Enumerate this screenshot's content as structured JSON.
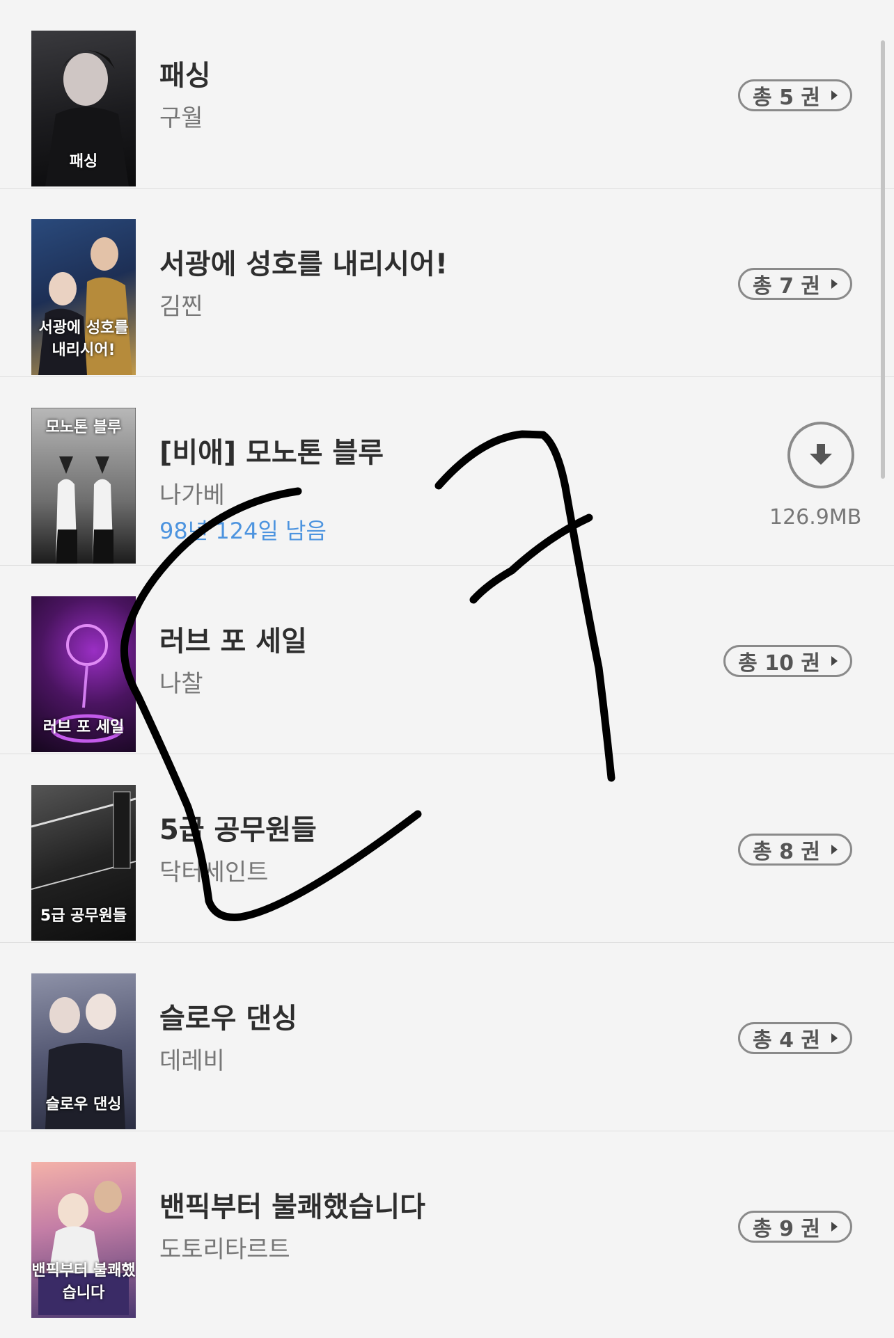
{
  "books": [
    {
      "title": "패싱",
      "author": "구월",
      "count_label": "총 5 권",
      "cover_text": "패싱",
      "cover_colors": [
        "#2b2b2e",
        "#0d0d0f"
      ]
    },
    {
      "title": "서광에 성호를 내리시어!",
      "author": "김찐",
      "count_label": "총 7 권",
      "cover_text": "서광에 성호를 내리시어!",
      "cover_colors": [
        "#1f3763",
        "#b48a3a"
      ]
    },
    {
      "title": "[비애] 모노톤 블루",
      "author": "나가베",
      "remaining": "98년 124일 남음",
      "size": "126.9MB",
      "cover_text": "모노톤 블루",
      "cover_colors": [
        "#9a9a9a",
        "#1a1a1a"
      ]
    },
    {
      "title": "러브 포 세일",
      "author": "나찰",
      "count_label": "총 10 권",
      "cover_text": "러브 포 세일",
      "cover_colors": [
        "#3a0f4a",
        "#b042d8"
      ]
    },
    {
      "title": "5급 공무원들",
      "author": "닥터세인트",
      "count_label": "총 8 권",
      "cover_text": "5급 공무원들",
      "cover_colors": [
        "#3b3b3b",
        "#0f0f0f"
      ]
    },
    {
      "title": "슬로우 댄싱",
      "author": "데레비",
      "count_label": "총 4 권",
      "cover_text": "슬로우 댄싱",
      "cover_colors": [
        "#6b6e86",
        "#2c2f44"
      ]
    },
    {
      "title": "밴픽부터 불쾌했습니다",
      "author": "도토리타르트",
      "count_label": "총 9 권",
      "cover_text": "밴픽부터 불쾌했습니다",
      "cover_colors": [
        "#f2a6a6",
        "#4a3870"
      ]
    }
  ],
  "icons": {
    "download": "download-arrow-icon",
    "chevron": "play-triangle-icon"
  },
  "colors": {
    "background": "#f4f4f4",
    "remaining_text": "#4d94df",
    "ink": "#000000"
  }
}
